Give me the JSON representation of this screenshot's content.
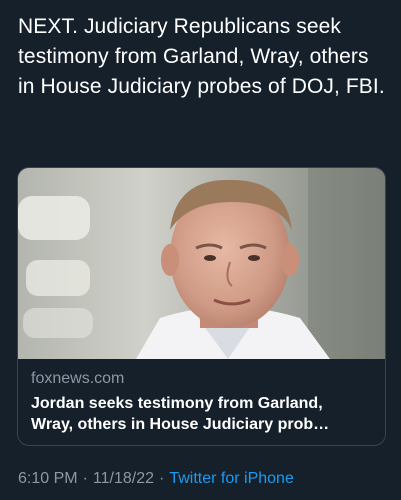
{
  "tweet": {
    "text": "NEXT. Judiciary Republicans seek testimony from Garland, Wray, others in House Judiciary probes of DOJ, FBI."
  },
  "link_card": {
    "domain": "foxnews.com",
    "title": "Jordan seeks testimony from Garland,\nWray, others in House Judiciary prob…",
    "image_icon": "news-photo-man-portrait"
  },
  "meta": {
    "time": "6:10 PM",
    "separator": "·",
    "date": "11/18/22",
    "source": "Twitter for iPhone"
  },
  "colors": {
    "background": "#15202b",
    "text": "#ffffff",
    "secondary_text": "#8b98a5",
    "link": "#1d9bf0",
    "card_border": "#38444d"
  }
}
